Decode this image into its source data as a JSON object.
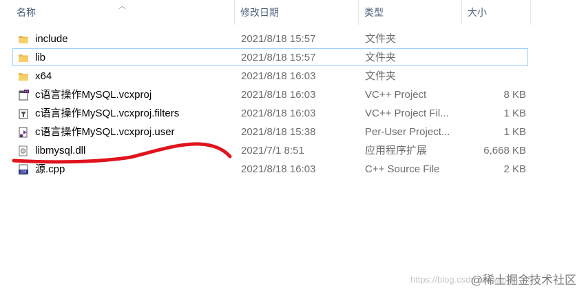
{
  "columns": {
    "name": "名称",
    "date": "修改日期",
    "type": "类型",
    "size": "大小"
  },
  "files": [
    {
      "name": "include",
      "date": "2021/8/18 15:57",
      "type": "文件夹",
      "size": "",
      "icon": "folder-icon"
    },
    {
      "name": "lib",
      "date": "2021/8/18 15:57",
      "type": "文件夹",
      "size": "",
      "icon": "folder-icon"
    },
    {
      "name": "x64",
      "date": "2021/8/18 16:03",
      "type": "文件夹",
      "size": "",
      "icon": "folder-icon"
    },
    {
      "name": "c语言操作MySQL.vcxproj",
      "date": "2021/8/18 16:03",
      "type": "VC++ Project",
      "size": "8 KB",
      "icon": "vcxproj-icon"
    },
    {
      "name": "c语言操作MySQL.vcxproj.filters",
      "date": "2021/8/18 16:03",
      "type": "VC++ Project Fil...",
      "size": "1 KB",
      "icon": "filters-icon"
    },
    {
      "name": "c语言操作MySQL.vcxproj.user",
      "date": "2021/8/18 15:38",
      "type": "Per-User Project...",
      "size": "1 KB",
      "icon": "user-file-icon"
    },
    {
      "name": "libmysql.dll",
      "date": "2021/7/1 8:51",
      "type": "应用程序扩展",
      "size": "6,668 KB",
      "icon": "dll-icon"
    },
    {
      "name": "源.cpp",
      "date": "2021/8/18 16:03",
      "type": "C++ Source File",
      "size": "2 KB",
      "icon": "cpp-icon"
    }
  ],
  "watermark": {
    "brand": "@稀土掘金技术社区",
    "url": "https://blog.csdn.net/weixin_45..."
  },
  "colors": {
    "folder": "#e8b94a",
    "focus_border": "#99d1ff",
    "annotation": "#e0141e"
  }
}
